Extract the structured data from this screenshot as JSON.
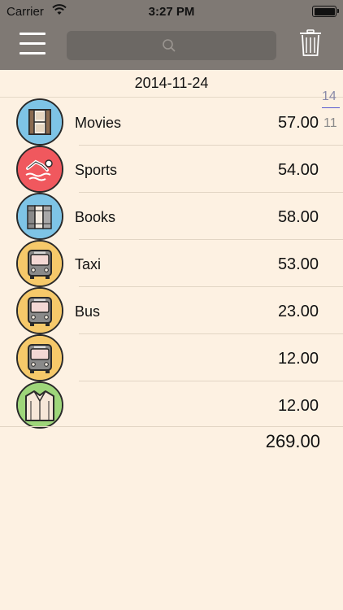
{
  "status_bar": {
    "carrier": "Carrier",
    "time": "3:27 PM"
  },
  "nav_bar": {
    "menu_icon": "hamburger-menu-icon",
    "search_placeholder": "",
    "search_icon": "magnifier-icon",
    "trash_icon": "trash-icon"
  },
  "date_header": "2014-11-24",
  "side_scroller": {
    "selected": "14",
    "next": "11"
  },
  "entries": [
    {
      "icon": "film-strip-icon",
      "color": "#7ec4e6",
      "label": "Movies",
      "amount": "57.00"
    },
    {
      "icon": "swimmer-icon",
      "color": "#f0585e",
      "label": "Sports",
      "amount": "54.00"
    },
    {
      "icon": "books-icon",
      "color": "#7ec4e6",
      "label": "Books",
      "amount": "58.00"
    },
    {
      "icon": "bus-icon",
      "color": "#f6c96a",
      "label": "Taxi",
      "amount": "53.00"
    },
    {
      "icon": "bus-icon",
      "color": "#f6c96a",
      "label": "Bus",
      "amount": "23.00"
    },
    {
      "icon": "bus-icon",
      "color": "#f6c96a",
      "label": "",
      "amount": "12.00"
    },
    {
      "icon": "shirt-icon",
      "color": "#9ed67a",
      "label": "",
      "amount": "12.00"
    }
  ],
  "total": "269.00"
}
